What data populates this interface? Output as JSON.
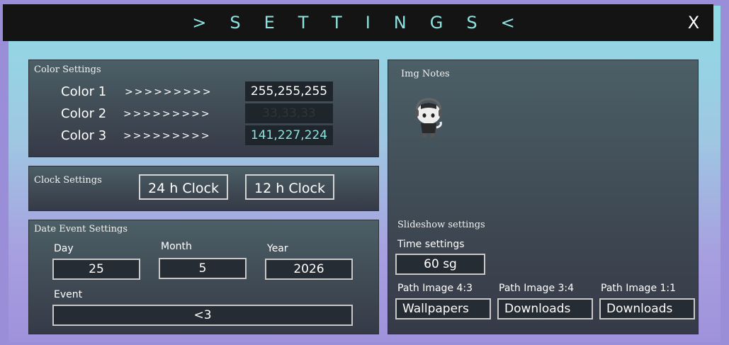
{
  "window": {
    "title": ">SETTINGS<",
    "close_label": "X"
  },
  "color_settings": {
    "title": "Color Settings",
    "rows": [
      {
        "label": "Color 1",
        "arrows": ">>>>>>>>>",
        "value": "255,255,255",
        "color": "#ffffff"
      },
      {
        "label": "Color 2",
        "arrows": ">>>>>>>>>",
        "value": "33,33,33",
        "color": "#212121"
      },
      {
        "label": "Color 3",
        "arrows": ">>>>>>>>>",
        "value": "141,227,224",
        "color": "#8de3e0"
      }
    ]
  },
  "clock_settings": {
    "title": "Clock Settings",
    "btn_24": "24 h Clock",
    "btn_12": "12 h Clock"
  },
  "date_event": {
    "title": "Date Event Settings",
    "day_label": "Day",
    "day_value": "25",
    "month_label": "Month",
    "month_value": "5",
    "year_label": "Year",
    "year_value": "2026",
    "event_label": "Event",
    "event_value": "<3"
  },
  "img_notes": {
    "title": "Img Notes"
  },
  "slideshow": {
    "title": "Slideshow settings",
    "time_label": "Time settings",
    "time_value": "60 sg",
    "path_43_label": "Path Image 4:3",
    "path_43_value": "Wallpapers",
    "path_34_label": "Path Image 3:4",
    "path_34_value": "Downloads",
    "path_11_label": "Path Image 1:1",
    "path_11_value": "Downloads"
  }
}
